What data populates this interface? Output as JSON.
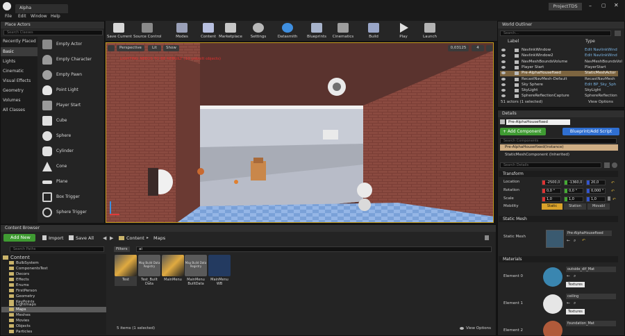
{
  "window": {
    "tab_name": "Alpha",
    "project_name": "ProjectTDS"
  },
  "menu": [
    "File",
    "Edit",
    "Window",
    "Help"
  ],
  "place_actors": {
    "tab": "Place Actors",
    "search_placeholder": "Search Classes",
    "categories": [
      "Recently Placed",
      "Basic",
      "Lights",
      "Cinematic",
      "Visual Effects",
      "Geometry",
      "Volumes",
      "All Classes"
    ],
    "selected_category": "Basic",
    "actors": [
      "Empty Actor",
      "Empty Character",
      "Empty Pawn",
      "Point Light",
      "Player Start",
      "Cube",
      "Sphere",
      "Cylinder",
      "Cone",
      "Plane",
      "Box Trigger",
      "Sphere Trigger"
    ]
  },
  "toolbar": [
    "Save Current",
    "Source Control",
    "Modes",
    "Content",
    "Marketplace",
    "Settings",
    "Datasmith",
    "Blueprints",
    "Cinematics",
    "Build",
    "Play",
    "Launch"
  ],
  "viewport": {
    "perspective": "Perspective",
    "lit": "Lit",
    "show": "Show",
    "warning": "LIGHTING NEEDS TO BE REBUILT (10 unbuilt objects)",
    "snap_value": "0,03125",
    "camera_speed": "4"
  },
  "world_outliner": {
    "tab": "World Outliner",
    "search_placeholder": "Search...",
    "col_label": "Label",
    "col_type": "Type",
    "rows": [
      {
        "label": "NavlinkWindow",
        "type": "Edit NavlinkWind"
      },
      {
        "label": "NavlinkWindow2",
        "type": "Edit NavlinkWind"
      },
      {
        "label": "NavMeshBoundsVolume",
        "type": "NavMeshBoundsVol"
      },
      {
        "label": "Player Start",
        "type": "PlayerStart"
      },
      {
        "label": "Pre-AlphaHousefixed",
        "type": "StaticMeshActor"
      },
      {
        "label": "RecastNavMesh-Default",
        "type": "RecastNavMesh"
      },
      {
        "label": "Sky Sphere",
        "type": "Edit BP_Sky_Sph"
      },
      {
        "label": "SkyLight",
        "type": "SkyLight"
      },
      {
        "label": "SphereReflectionCapture",
        "type": "SphereReflection"
      }
    ],
    "selected_index": 4,
    "status": "51 actors (1 selected)",
    "view_options": "View Options"
  },
  "details": {
    "tab": "Details",
    "name_value": "Pre-AlphaHousefixed",
    "add_component": "+ Add Component",
    "blueprint_button": "Blueprint/Add Script",
    "search_components": "Search Components",
    "component_instance": "Pre-AlphaHousefixed(Instance)",
    "component_child": "StaticMeshComponent (Inherited)",
    "search_details": "Search Details",
    "transform_header": "Transform",
    "location_label": "Location",
    "location": [
      "-2500,0",
      "-1360,0",
      "20,0"
    ],
    "rotation_label": "Rotation",
    "rotation": [
      "0,0 °",
      "0,0 °",
      "0,000 °"
    ],
    "scale_label": "Scale",
    "scale": [
      "1,0",
      "1,0",
      "1,0"
    ],
    "mobility_label": "Mobility",
    "mobility": [
      "Static",
      "Station",
      "Movabl"
    ],
    "static_mesh_header": "Static Mesh",
    "static_mesh_label": "Static Mesh",
    "static_mesh_value": "Pre-AlphaHousefixed",
    "materials_header": "Materials",
    "materials": [
      {
        "element": "Element 0",
        "name": "outside_dif_Mat",
        "textures": "Textures"
      },
      {
        "element": "Element 1",
        "name": "ceiling",
        "textures": "Textures"
      },
      {
        "element": "Element 2",
        "name": "foundation_Mat",
        "textures": ""
      }
    ]
  },
  "content_browser": {
    "tab": "Content Browser",
    "add_new": "Add New",
    "import": "Import",
    "save_all": "Save All",
    "breadcrumb": [
      "Content",
      "Maps"
    ],
    "search_paths_placeholder": "Search Paths",
    "filters": "Filters",
    "search_value": "ai",
    "tree": [
      "Content",
      "BulbSystem",
      "ComponentsTest",
      "Decors",
      "Effects",
      "Enums",
      "FirstPerson",
      "Geometry",
      "KeyPoints",
      "Lightmaps",
      "Maps",
      "Meshes",
      "Movies",
      "Objects",
      "Particles"
    ],
    "selected_folder": "Maps",
    "assets": [
      {
        "name": "Test",
        "thumb": "map"
      },
      {
        "name": "Test_Built Data",
        "thumb": "data",
        "thumb_text": "Map Build Data Registry"
      },
      {
        "name": "MainMenu",
        "thumb": "map"
      },
      {
        "name": "MainMenu BuiltData",
        "thumb": "data",
        "thumb_text": "Map Build Data Registry"
      },
      {
        "name": "MainMenu WB",
        "thumb": "widget"
      }
    ],
    "status": "5 items (1 selected)",
    "view_options": "View Options"
  }
}
